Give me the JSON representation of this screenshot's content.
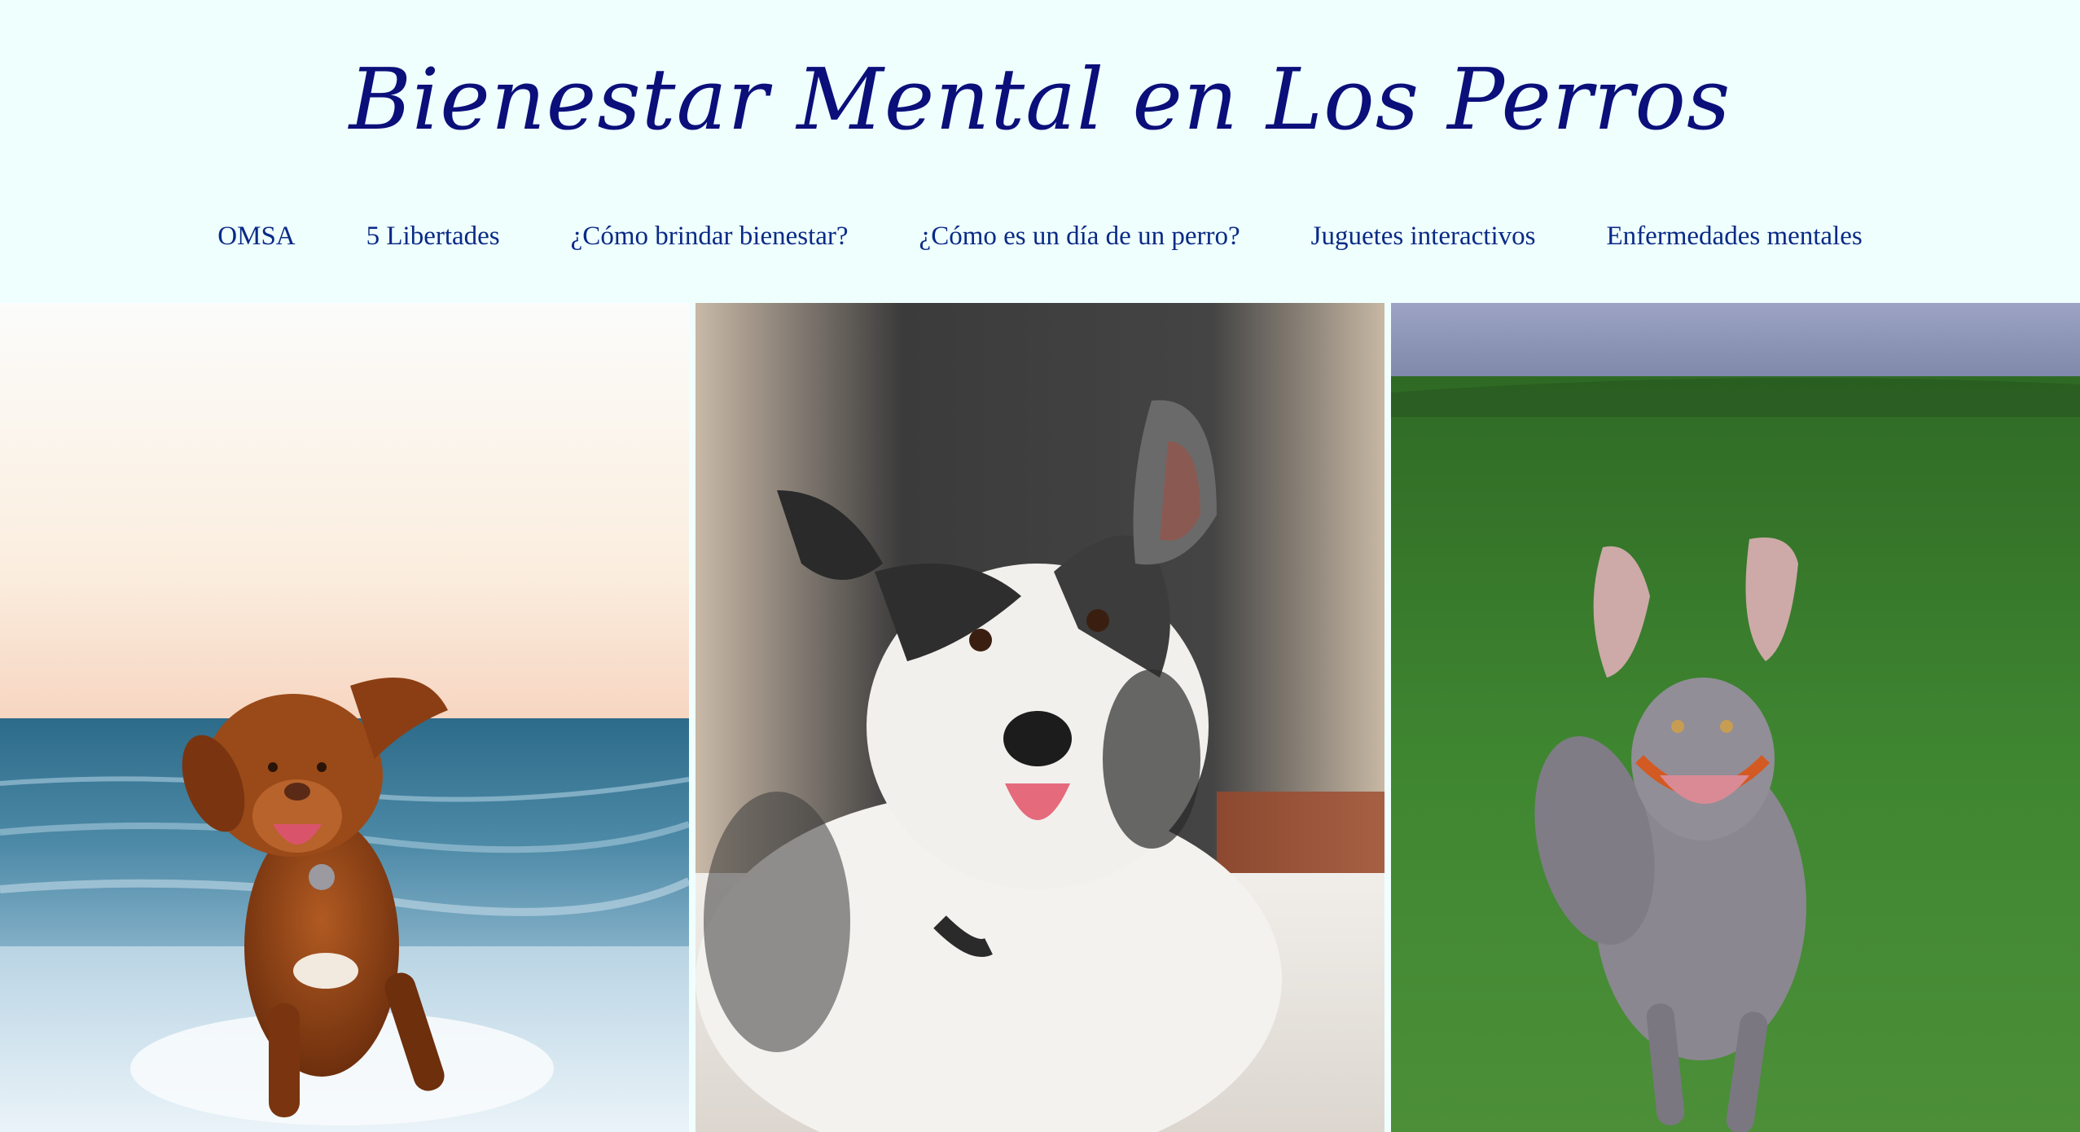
{
  "site": {
    "title": "Bienestar Mental en Los Perros"
  },
  "nav": {
    "items": [
      {
        "label": "OMSA",
        "name": "nav-link-omsa"
      },
      {
        "label": "5 Libertades",
        "name": "nav-link-5-libertades"
      },
      {
        "label": "¿Cómo brindar bienestar?",
        "name": "nav-link-como-brindar-bienestar"
      },
      {
        "label": "¿Cómo es un día de un perro?",
        "name": "nav-link-dia-de-un-perro"
      },
      {
        "label": "Juguetes interactivos",
        "name": "nav-link-juguetes-interactivos"
      },
      {
        "label": "Enfermedades mentales",
        "name": "nav-link-enfermedades-mentales"
      }
    ]
  },
  "gallery": {
    "photos": [
      {
        "name": "photo-dog-beach",
        "subject": "brown retriever running on beach"
      },
      {
        "name": "photo-dog-border-collie",
        "subject": "white and black merle collie lying on bed"
      },
      {
        "name": "photo-dog-weimaraner",
        "subject": "grey weimaraner running on grass"
      }
    ]
  },
  "colors": {
    "background": "#effffe",
    "title": "#0b0f7a",
    "nav_link": "#0a2a86"
  }
}
